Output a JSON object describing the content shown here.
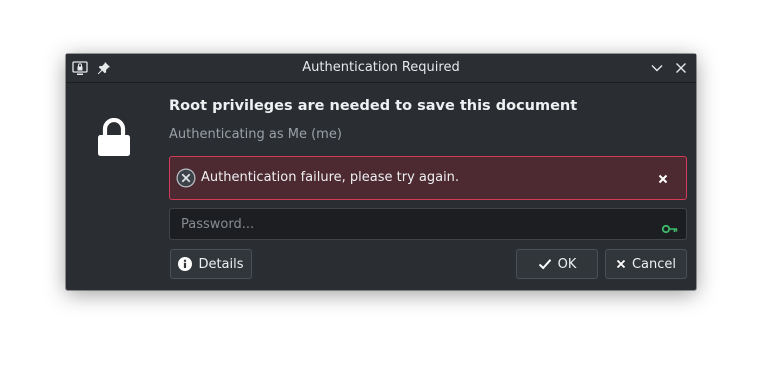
{
  "window": {
    "title": "Authentication Required",
    "titlebar_icons": [
      "screen-lock-icon",
      "pin-icon"
    ],
    "controls": [
      "chevron-down-icon",
      "close-icon"
    ]
  },
  "dialog": {
    "icon": "lock-icon",
    "headline": "Root privileges are needed to save this document",
    "subline": "Authenticating as Me (me)"
  },
  "error": {
    "icon": "error-x-icon",
    "message": "Authentication failure, please try again.",
    "border_color": "#d03c57",
    "background_color": "#4d2a32"
  },
  "password": {
    "placeholder": "Password...",
    "value": "",
    "trailing_icon": "key-icon",
    "trailing_icon_color": "#3dbb6a"
  },
  "buttons": {
    "details_label": "Details",
    "ok_label": "OK",
    "cancel_label": "Cancel"
  }
}
